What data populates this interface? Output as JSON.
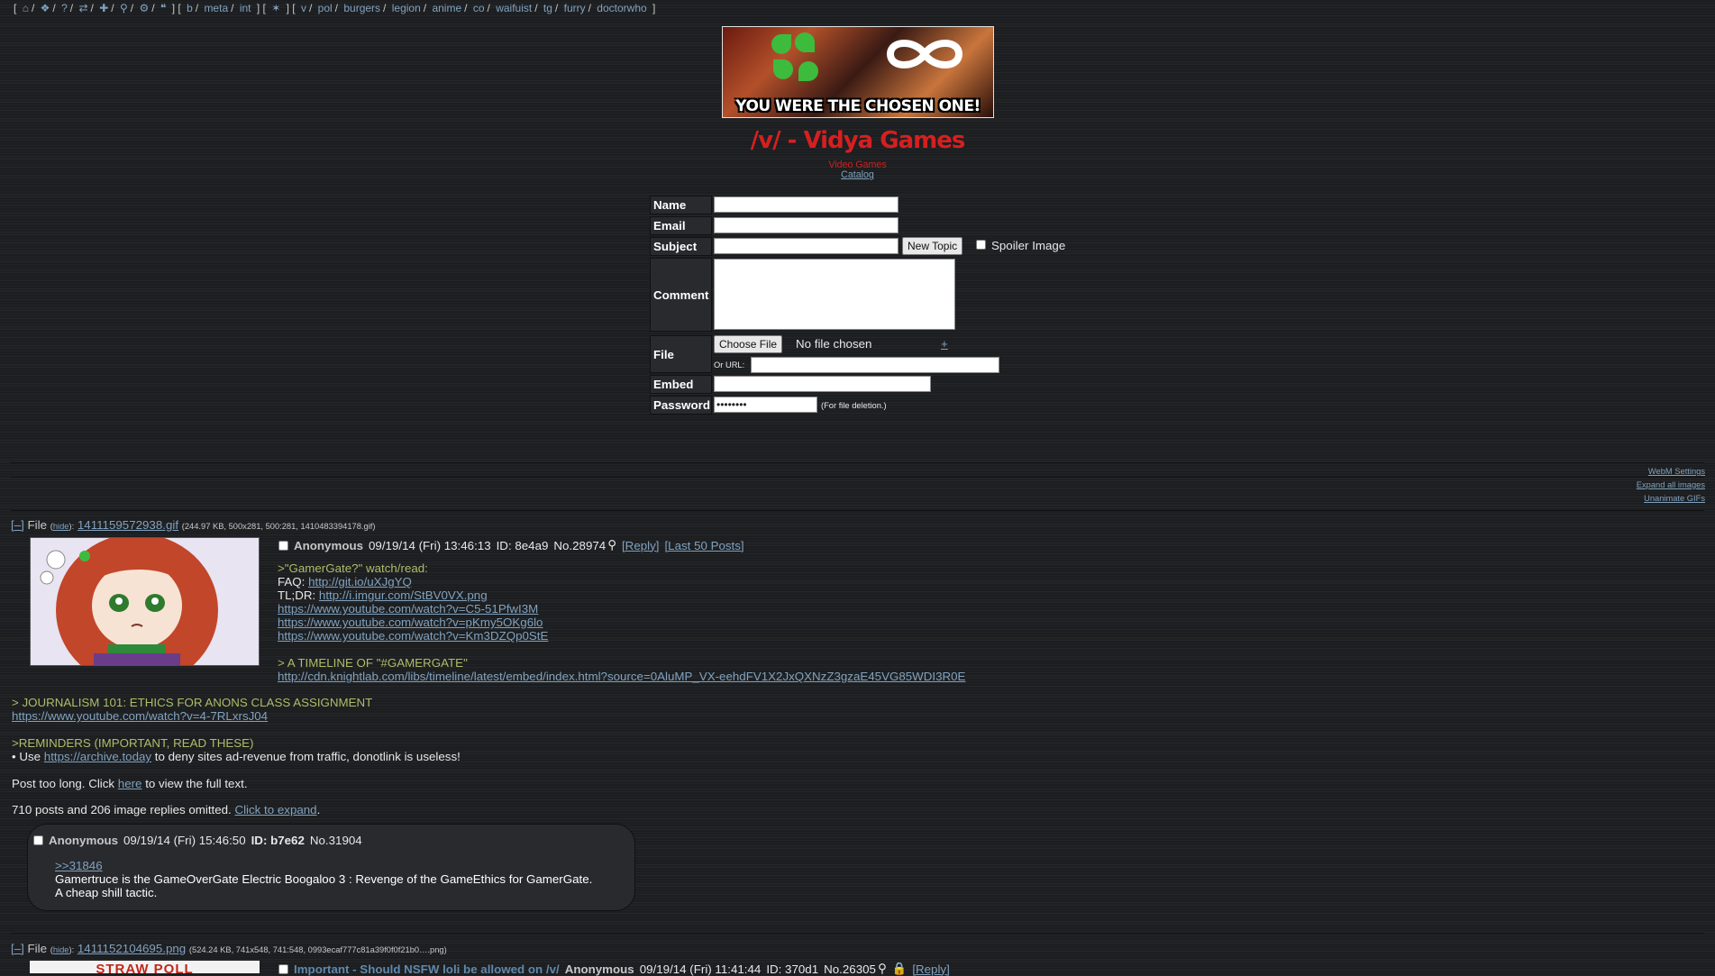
{
  "topbar": {
    "icons": [
      "home-icon",
      "tags-icon",
      "help-icon",
      "random-icon",
      "create-icon",
      "search-icon",
      "gear-icon",
      "quote-icon"
    ],
    "group1": [
      "b",
      "meta",
      "int"
    ],
    "group2_icon": "twitter-icon",
    "group3": [
      "v",
      "pol",
      "burgers",
      "legion",
      "anime",
      "co",
      "waifuist",
      "tg",
      "furry",
      "doctorwho"
    ]
  },
  "banner": {
    "text": "YOU WERE THE CHOSEN ONE!"
  },
  "board": {
    "title": "/v/ - Vidya Games",
    "subtitle": "Video Games",
    "catalog": "Catalog"
  },
  "form": {
    "name_label": "Name",
    "email_label": "Email",
    "subject_label": "Subject",
    "comment_label": "Comment",
    "file_label": "File",
    "embed_label": "Embed",
    "password_label": "Password",
    "new_topic_button": "New Topic",
    "spoiler_label": "Spoiler Image",
    "choose_file_button": "Choose File",
    "no_file_text": "No file chosen",
    "add_file": "+",
    "or_url": "Or URL:",
    "password_value": "••••••••",
    "password_note": "(For file deletion.)"
  },
  "side_links": {
    "webm": "WebM Settings",
    "expand": "Expand all images",
    "unanimate": "Unanimate GIFs"
  },
  "thread1": {
    "collapse": "[–]",
    "file_word": "File",
    "hide": "hide",
    "filename": "1411159572938.gif",
    "filemeta": "(244.97 KB, 500x281, 500:281, 1410483394178.gif)",
    "name": "Anonymous",
    "date": "09/19/14 (Fri) 13:46:13",
    "id": "ID: 8e4a9",
    "no": "No.28974",
    "reply": "[Reply]",
    "last50": "[Last 50 Posts]",
    "lines": {
      "q1": ">\"GamerGate?\" watch/read:",
      "faq_label": "FAQ:",
      "faq_link": "http://git.io/uXJgYQ",
      "tldr_label": "TL;DR:",
      "tldr_link": "http://i.imgur.com/StBV0VX.png",
      "yt1": "https://www.youtube.com/watch?v=C5-51PfwI3M",
      "yt2": "https://www.youtube.com/watch?v=pKmy5OKg6lo",
      "yt3": "https://www.youtube.com/watch?v=Km3DZQp0StE",
      "timeline_quote": "> A TIMELINE OF \"#GAMERGATE\"",
      "timeline_link": "http://cdn.knightlab.com/libs/timeline/latest/embed/index.html?source=0AluMP_VX-eehdFV1X2JxQXNzZ3gzaE45VG85WDI3R0E",
      "journalism_quote": "> JOURNALISM 101: ETHICS FOR ANONS CLASS ASSIGNMENT",
      "journalism_link": "https://www.youtube.com/watch?v=4-7RLxrsJ04",
      "reminders_quote": ">REMINDERS (IMPORTANT, READ THESE)",
      "use_prefix": "• Use",
      "archive_link": "https://archive.today",
      "use_suffix": "to deny sites ad-revenue from traffic, donotlink is useless!",
      "toolong_prefix": "Post too long. Click",
      "toolong_link": "here",
      "toolong_suffix": "to view the full text.",
      "omitted": "710 posts and 206 image replies omitted.",
      "expand_link": "Click to expand"
    }
  },
  "reply1": {
    "name": "Anonymous",
    "date": "09/19/14 (Fri) 15:46:50",
    "id_label": "ID:",
    "id": "b7e62",
    "no": "No.31904",
    "quote_link": ">>31846",
    "line1": "Gamertruce is the GameOverGate Electric Boogaloo 3 : Revenge of the GameEthics for GamerGate.",
    "line2": "A cheap shill tactic."
  },
  "thread2": {
    "collapse": "[–]",
    "file_word": "File",
    "hide": "hide",
    "filename": "1411152104695.png",
    "filemeta": "(524.24 KB, 741x548, 741:548, 0993ecaf777c81a39f0f0f21b0….png)",
    "thumb_text": "STRAW POLL",
    "subject": "Important - Should NSFW loli be allowed on /v/",
    "name": "Anonymous",
    "date": "09/19/14 (Fri) 11:41:44",
    "id": "ID: 370d1",
    "no": "No.26305",
    "reply": "[Reply]"
  }
}
